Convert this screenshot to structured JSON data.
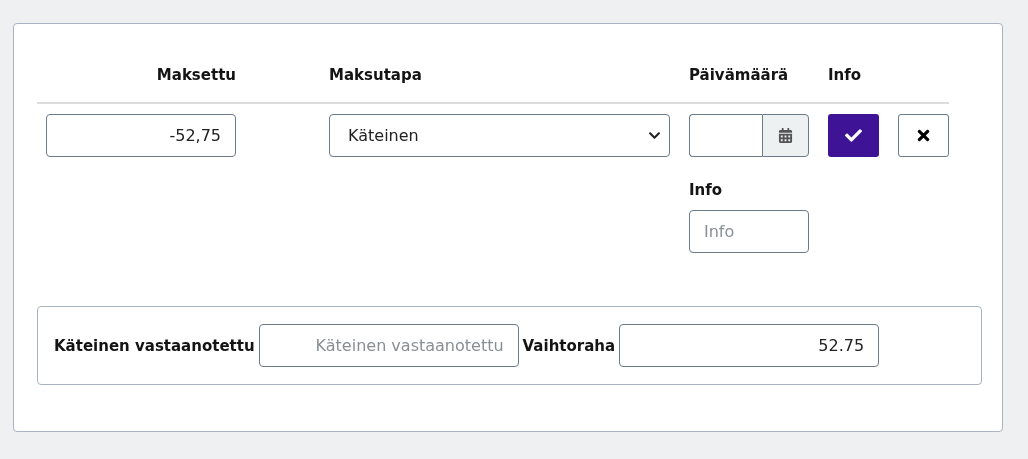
{
  "columns": [
    "Maksettu",
    "Maksutapa",
    "Päivämäärä",
    "Info"
  ],
  "payment": {
    "paid": "-52,75",
    "method": "Käteinen",
    "info_label": "Info",
    "info_placeholder": "Info"
  },
  "summary": {
    "received_label": "Käteinen vastaanotettu",
    "received_placeholder": "Käteinen vastaanotettu",
    "change_label": "Vaihtoraha",
    "change_value": "52.75"
  }
}
